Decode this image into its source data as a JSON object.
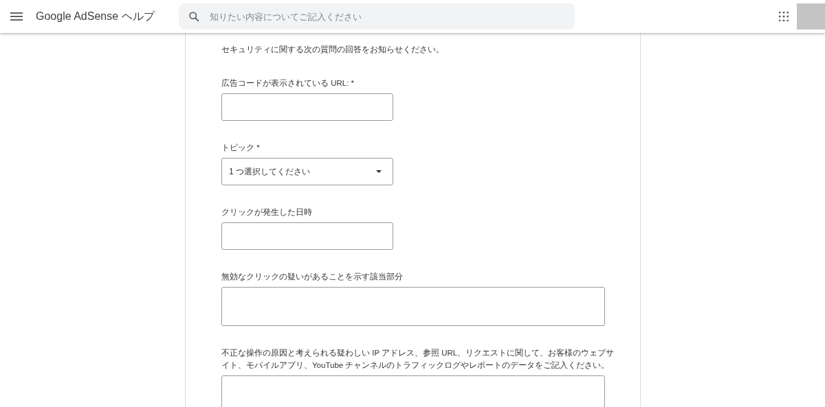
{
  "header": {
    "title": "Google AdSense ヘルプ",
    "search": {
      "placeholder": "知りたい内容についてご記入ください"
    }
  },
  "form": {
    "intro": "セキュリティに関する次の質問の回答をお知らせください。",
    "fields": [
      {
        "kind": "text",
        "label": "広告コードが表示されている URL: *"
      },
      {
        "kind": "select",
        "label": "トピック *",
        "value": "1 つ選択してください"
      },
      {
        "kind": "text",
        "label": "クリックが発生した日時"
      },
      {
        "kind": "textarea",
        "label": "無効なクリックの疑いがあることを示す該当部分"
      },
      {
        "kind": "textarea",
        "label": "不正な操作の原因と考えられる疑わしい IP アドレス、参照 URL、リクエストに関して、お客様のウェブサイト、モバイルアプリ、YouTube チャンネルのトラフィックログやレポートのデータをご記入ください。"
      }
    ]
  }
}
